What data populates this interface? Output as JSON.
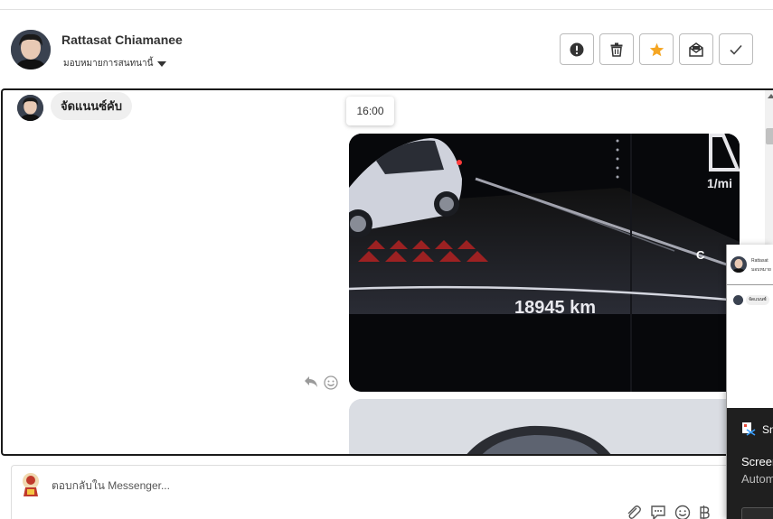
{
  "header": {
    "contact_name": "Rattasat Chiamanee",
    "assign_label": "มอบหมายการสนทนานี้",
    "actions": [
      {
        "icon": "alert-icon",
        "name": "report-button"
      },
      {
        "icon": "trash-icon",
        "name": "delete-button"
      },
      {
        "icon": "star-icon",
        "name": "star-button"
      },
      {
        "icon": "unread-mail-icon",
        "name": "mark-unread-button"
      },
      {
        "icon": "check-icon",
        "name": "done-button"
      }
    ]
  },
  "conversation": {
    "first_message": "จัดแนนซ์คับ",
    "time_tooltip": "16:00",
    "odometer_text": "18945 km",
    "gauge_unit": "1/mi",
    "gauge_letter": "C"
  },
  "reply": {
    "placeholder": "ตอบกลับใน Messenger..."
  },
  "popup": {
    "header_name": "Rattasat",
    "header_sub": "มอบหมาย",
    "bubble_text": "จัดแนนซ์",
    "title": "Sn",
    "line1": "Screen",
    "line2": "Autom"
  },
  "colors": {
    "star": "#f5a623",
    "border": "#1a1a1a",
    "bubble_bg": "#efefef"
  }
}
